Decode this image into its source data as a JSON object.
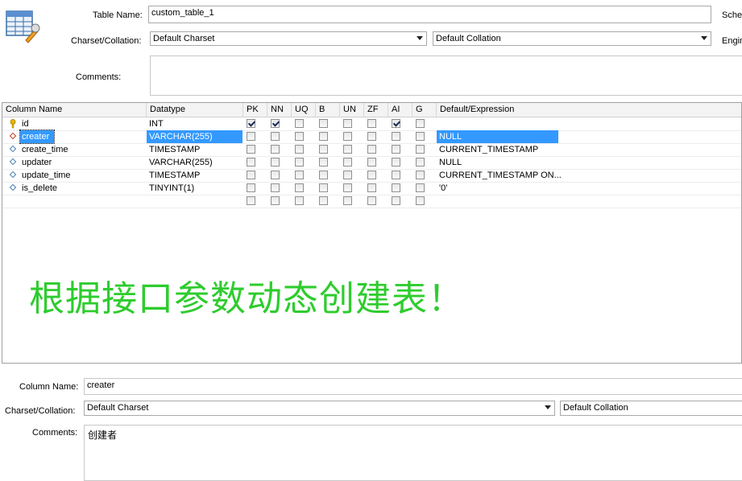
{
  "table": {
    "name_label": "Table Name:",
    "name_value": "custom_table_1",
    "schema_label": "Schem",
    "charset_label": "Charset/Collation:",
    "charset_value": "Default Charset",
    "collation_value": "Default Collation",
    "engine_label": "Engin",
    "comments_label": "Comments:"
  },
  "grid": {
    "headers": [
      "Column Name",
      "Datatype",
      "PK",
      "NN",
      "UQ",
      "B",
      "UN",
      "ZF",
      "AI",
      "G",
      "Default/Expression"
    ],
    "rows": [
      {
        "icon": "key-icon",
        "name": "id",
        "datatype": "INT",
        "flags": [
          true,
          true,
          false,
          false,
          false,
          false,
          true,
          false
        ],
        "default": ""
      },
      {
        "icon": "diamond-red-icon",
        "name": "creater",
        "datatype": "VARCHAR(255)",
        "flags": [
          false,
          false,
          false,
          false,
          false,
          false,
          false,
          false
        ],
        "default": "NULL",
        "selected": true
      },
      {
        "icon": "diamond-blue-icon",
        "name": "create_time",
        "datatype": "TIMESTAMP",
        "flags": [
          false,
          false,
          false,
          false,
          false,
          false,
          false,
          false
        ],
        "default": "CURRENT_TIMESTAMP"
      },
      {
        "icon": "diamond-blue-icon",
        "name": "updater",
        "datatype": "VARCHAR(255)",
        "flags": [
          false,
          false,
          false,
          false,
          false,
          false,
          false,
          false
        ],
        "default": "NULL"
      },
      {
        "icon": "diamond-blue-icon",
        "name": "update_time",
        "datatype": "TIMESTAMP",
        "flags": [
          false,
          false,
          false,
          false,
          false,
          false,
          false,
          false
        ],
        "default": "CURRENT_TIMESTAMP  ON..."
      },
      {
        "icon": "diamond-blue-icon",
        "name": "is_delete",
        "datatype": "TINYINT(1)",
        "flags": [
          false,
          false,
          false,
          false,
          false,
          false,
          false,
          false
        ],
        "default": "'0'"
      },
      {
        "icon": "",
        "name": "",
        "datatype": "",
        "flags": [
          false,
          false,
          false,
          false,
          false,
          false,
          false,
          false
        ],
        "default": ""
      }
    ]
  },
  "banner": "根据接口参数动态创建表！",
  "column": {
    "name_label": "Column Name:",
    "name_value": "creater",
    "charset_label": "Charset/Collation:",
    "charset_value": "Default Charset",
    "collation_value": "Default Collation",
    "comments_label": "Comments:",
    "comments_value": "创建者"
  },
  "colors": {
    "selection": "#3399ff",
    "banner_green": "#2ecc2e",
    "key_yellow": "#e8b800",
    "diamond_red": "#c0392b",
    "diamond_blue": "#4a7fb5"
  }
}
